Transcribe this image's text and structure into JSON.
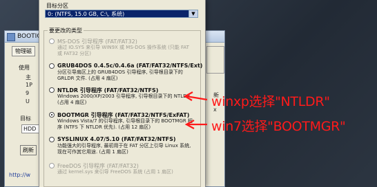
{
  "bg_window": {
    "title": "BOOTICE",
    "tab": "物理磁",
    "group_label": "使用",
    "side_text_1": "主",
    "side_text_2": "1P",
    "side_text_3": "9",
    "side_text_4": "U",
    "target_label": "目标",
    "target_value": "HDD",
    "refresh_button": "刷新",
    "link": "http://w",
    "right_text_1": "新",
    "right_text_2": "x"
  },
  "dialog": {
    "target_partition_label": "目标分区",
    "target_partition_value": "0: (NTFS, 15.0 GB, C:\\, 系统)",
    "group_title": "要更改的类型",
    "options": [
      {
        "title": "MS-DOS 引导程序 (FAT/FAT32)",
        "desc": "通过 IO.SYS 来引导 WIN9X 或 MS-DOS 操作系统 (只能 FAT 或 FAT32 分区)",
        "selected": false,
        "disabled": true
      },
      {
        "title": "GRUB4DOS 0.4.5c/0.4.6a (FAT/FAT32/NTFS/Ext)",
        "desc": "分区引导扇区上的 GRUB4DOS 引导程序, 引导根目录下的 GRLDR 文件. (占用 4 扇区)",
        "selected": false,
        "disabled": false
      },
      {
        "title": "NTLDR 引导程序 (FAT/FAT32/NTFS)",
        "desc": "Windows 2000/XP/2003 引导程序, 引导根目录下的 NTLDR. (占用 4 扇区)",
        "selected": false,
        "disabled": false
      },
      {
        "title": "BOOTMGR 引导程序 (FAT/FAT32/NTFS/ExFAT)",
        "desc": "Windows Vista/7 的引导程序, 引导根目录下的 BOOTMGR 程序 (NTFS 下 NTLDR 优先). (占用 12 扇区)",
        "selected": true,
        "disabled": false
      },
      {
        "title": "SYSLINUX 4.07/5.10 (FAT/FAT32/NTFS)",
        "desc": "功能强大的引导程序, 最初用于在 FAT 分区上引导 Linux 系统, 现在可作其它用途. (占用 1 扇区)",
        "selected": false,
        "disabled": false
      },
      {
        "title": "FreeDOS 引导程序 (FAT/FAT32)",
        "desc": "通过 kernel.sys 来引导 FreeDOS 系统 (占用 1 扇区)",
        "selected": false,
        "disabled": true
      }
    ]
  },
  "annotations": {
    "winxp": "winxp选择\"NTLDR\"",
    "win7": "win7选择\"BOOTMGR\"",
    "color": "#ff1a1a"
  }
}
